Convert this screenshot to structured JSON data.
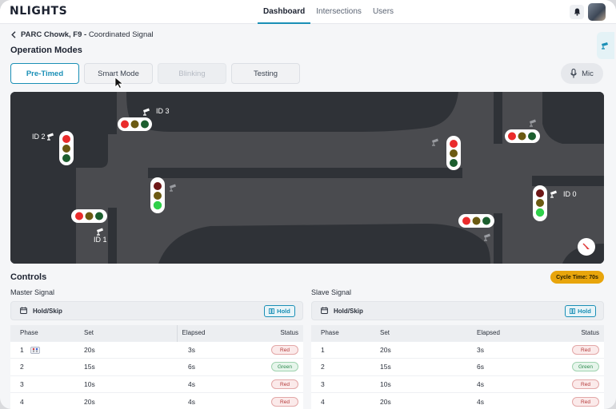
{
  "app": {
    "logo": "NLIGHTS",
    "nav": [
      "Dashboard",
      "Intersections",
      "Users"
    ],
    "active_nav": "Dashboard"
  },
  "breadcrumb": {
    "site": "PARC Chowk, F9",
    "separator": "-",
    "detail": "Coordinated Signal"
  },
  "operation": {
    "title": "Operation Modes",
    "modes": [
      {
        "label": "Pre-Timed",
        "state": "active"
      },
      {
        "label": "Smart Mode",
        "state": "normal"
      },
      {
        "label": "Blinking",
        "state": "disabled"
      },
      {
        "label": "Testing",
        "state": "normal"
      }
    ],
    "mic_label": "Mic"
  },
  "map": {
    "signal_ids": [
      "ID 0",
      "ID 1",
      "ID 2",
      "ID 3"
    ]
  },
  "controls": {
    "title": "Controls",
    "cycle_time": "Cycle Time: 70s",
    "master": {
      "label": "Master Signal",
      "hold_title": "Hold/Skip",
      "hold_button": "Hold",
      "columns": [
        "Phase",
        "Set",
        "Elapsed",
        "Status"
      ],
      "rows": [
        {
          "phase": "1",
          "set": "20s",
          "elapsed": "3s",
          "status": "Red"
        },
        {
          "phase": "2",
          "set": "15s",
          "elapsed": "6s",
          "status": "Green"
        },
        {
          "phase": "3",
          "set": "10s",
          "elapsed": "4s",
          "status": "Red"
        },
        {
          "phase": "4",
          "set": "20s",
          "elapsed": "4s",
          "status": "Red"
        }
      ]
    },
    "slave": {
      "label": "Slave Signal",
      "hold_title": "Hold/Skip",
      "hold_button": "Hold",
      "columns": [
        "Phase",
        "Set",
        "Elapsed",
        "Status"
      ],
      "rows": [
        {
          "phase": "1",
          "set": "20s",
          "elapsed": "3s",
          "status": "Red"
        },
        {
          "phase": "2",
          "set": "15s",
          "elapsed": "6s",
          "status": "Green"
        },
        {
          "phase": "3",
          "set": "10s",
          "elapsed": "4s",
          "status": "Red"
        },
        {
          "phase": "4",
          "set": "20s",
          "elapsed": "4s",
          "status": "Red"
        }
      ]
    }
  },
  "colors": {
    "accent": "#1a8fb6",
    "cycle_badge": "#e8a50c",
    "road": "#4a4b4f",
    "block": "#2f3237"
  }
}
